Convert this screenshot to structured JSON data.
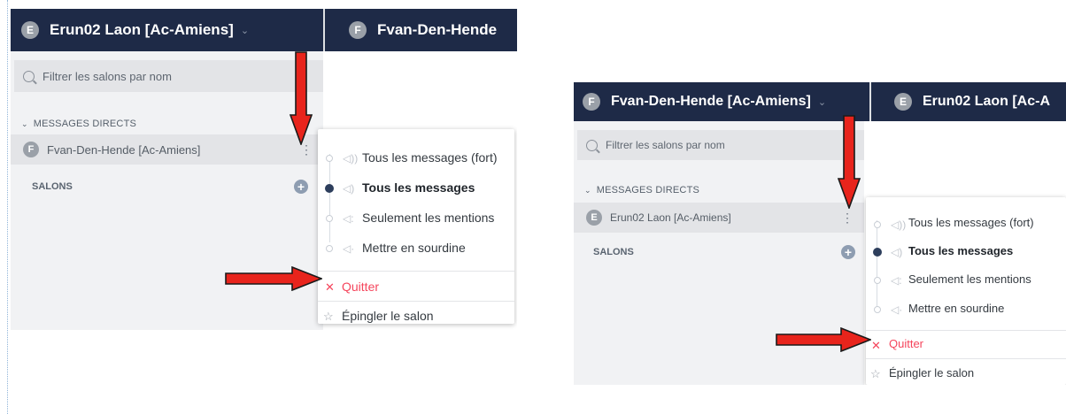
{
  "left": {
    "header": {
      "avatar_letter": "E",
      "title": "Erun02 Laon [Ac-Amiens]",
      "chevron": "⌄",
      "second_avatar_letter": "F",
      "second_title": "Fvan-Den-Hende"
    },
    "search": {
      "placeholder": "Filtrer les salons par nom"
    },
    "direct_messages": {
      "section_label": "MESSAGES DIRECTS",
      "item_avatar_letter": "F",
      "item_name": "Fvan-Den-Hende [Ac-Amiens]"
    },
    "salons": {
      "label": "SALONS",
      "add_icon": "+"
    },
    "menu": {
      "notif_loud": "Tous les messages (fort)",
      "notif_all": "Tous les messages",
      "notif_mentions": "Seulement les mentions",
      "notif_mute": "Mettre en sourdine",
      "quit": "Quitter",
      "pin": "Épingler le salon"
    }
  },
  "right": {
    "header": {
      "avatar_letter": "F",
      "title": "Fvan-Den-Hende [Ac-Amiens]",
      "chevron": "⌄",
      "second_avatar_letter": "E",
      "second_title": "Erun02 Laon [Ac-A"
    },
    "search": {
      "placeholder": "Filtrer les salons par nom"
    },
    "direct_messages": {
      "section_label": "MESSAGES DIRECTS",
      "item_avatar_letter": "E",
      "item_name": "Erun02 Laon [Ac-Amiens]"
    },
    "salons": {
      "label": "SALONS",
      "add_icon": "+"
    },
    "menu": {
      "notif_loud": "Tous les messages (fort)",
      "notif_all": "Tous les messages",
      "notif_mentions": "Seulement les mentions",
      "notif_mute": "Mettre en sourdine",
      "quit": "Quitter",
      "pin": "Épingler le salon"
    }
  },
  "colors": {
    "header_bg": "#1e2a47",
    "sidebar_bg": "#f1f2f4",
    "quit_red": "#f5455c",
    "arrow_red": "#e8241c",
    "selected_dot": "#2d3e5c"
  },
  "icons": {
    "search": "search-icon",
    "kebab": "kebab-menu-icon",
    "add": "plus-circle-icon",
    "speaker": "speaker-icon",
    "quit": "close-icon",
    "pin": "star-icon",
    "annotation": "red-arrow"
  }
}
